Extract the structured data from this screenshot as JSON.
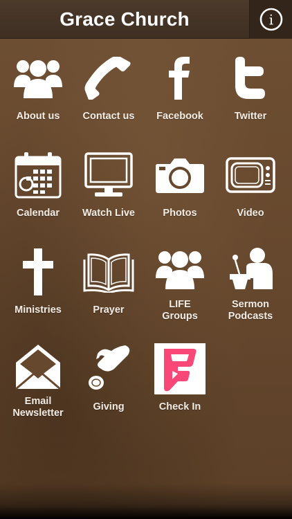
{
  "app": {
    "title": "Grace Church",
    "info_label": "i"
  },
  "tiles": [
    {
      "label": "About us",
      "icon": "group-icon"
    },
    {
      "label": "Contact us",
      "icon": "phone-icon"
    },
    {
      "label": "Facebook",
      "icon": "facebook-icon"
    },
    {
      "label": "Twitter",
      "icon": "twitter-icon"
    },
    {
      "label": "Calendar",
      "icon": "calendar-icon"
    },
    {
      "label": "Watch Live",
      "icon": "monitor-icon"
    },
    {
      "label": "Photos",
      "icon": "camera-icon"
    },
    {
      "label": "Video",
      "icon": "tv-icon"
    },
    {
      "label": "Ministries",
      "icon": "cross-icon"
    },
    {
      "label": "Prayer",
      "icon": "book-icon"
    },
    {
      "label": "LIFE\nGroups",
      "icon": "group-icon"
    },
    {
      "label": "Sermon\nPodcasts",
      "icon": "speaker-podium-icon"
    },
    {
      "label": "Email\nNewsletter",
      "icon": "envelope-icon"
    },
    {
      "label": "Giving",
      "icon": "coin-hand-icon"
    },
    {
      "label": "Check In",
      "icon": "foursquare-icon"
    }
  ],
  "colors": {
    "header_bg": "#3e2f22",
    "background": "#66482e",
    "text": "#ffffff",
    "foursquare": "#f94877"
  }
}
